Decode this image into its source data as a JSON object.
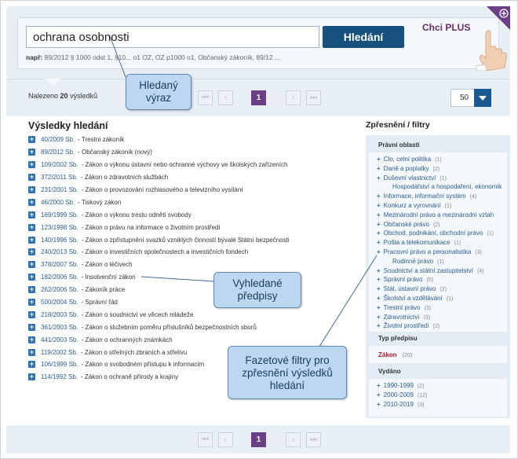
{
  "search": {
    "value": "ochrana osobnosti",
    "button_label": "Hledání",
    "example_label": "např:",
    "example_text": "89/2012 § 1000 odst 1, §10... o1 OZ, OZ p1000 o1, Občanský zákoník, 89/12 ..."
  },
  "promo": {
    "label": "Chci PLUS"
  },
  "pager": {
    "found_prefix": "Nalezeno",
    "found_count": "20",
    "found_suffix": "výsledků",
    "current_page": "1",
    "first": "⏮",
    "prev": "‹",
    "next": "›",
    "last": "⏭",
    "per_page": "50"
  },
  "results": {
    "title": "Výsledky hledání",
    "items": [
      {
        "num": "40/2009 Sb.",
        "title": "- Trestní zákoník"
      },
      {
        "num": "89/2012 Sb.",
        "title": "- Občanský zákoník (nový)"
      },
      {
        "num": "109/2002 Sb.",
        "title": "- Zákon o výkonu ústavní nebo ochranné výchovy ve školských zařízeních"
      },
      {
        "num": "372/2011 Sb.",
        "title": "- Zákon o zdravotních službách"
      },
      {
        "num": "231/2001 Sb.",
        "title": "- Zákon o provozování rozhlasového a televizního vysílání"
      },
      {
        "num": "46/2000 Sb.",
        "title": "- Tiskový zákon"
      },
      {
        "num": "169/1999 Sb.",
        "title": "- Zákon o výkonu trestu odnětí svobody"
      },
      {
        "num": "123/1998 Sb.",
        "title": "- Zákon o právu na informace o životním prostředí"
      },
      {
        "num": "140/1996 Sb.",
        "title": "- Zákon o zpřístupnění svazků vzniklých činností bývalé Státní bezpečnosti"
      },
      {
        "num": "240/2013 Sb.",
        "title": "- Zákon o investičních společnostech a investičních fondech"
      },
      {
        "num": "378/2007 Sb.",
        "title": "- Zákon o léčivech"
      },
      {
        "num": "182/2006 Sb.",
        "title": "- Insolvenční zákon"
      },
      {
        "num": "262/2006 Sb.",
        "title": "- Zákoník práce"
      },
      {
        "num": "500/2004 Sb.",
        "title": "- Správní řád"
      },
      {
        "num": "218/2003 Sb.",
        "title": "- Zákon o soudnictví ve věcech mládeže"
      },
      {
        "num": "361/2003 Sb.",
        "title": "- Zákon o služebním poměru příslušníků bezpečnostních sborů"
      },
      {
        "num": "441/2003 Sb.",
        "title": "- Zákon o ochranných známkách"
      },
      {
        "num": "119/2002 Sb.",
        "title": "- Zákon o střelných zbraních a střelivu"
      },
      {
        "num": "106/1999 Sb.",
        "title": "- Zákon o svobodném přístupu k informacím"
      },
      {
        "num": "114/1992 Sb.",
        "title": "- Zákon o ochraně přírody a krajiny"
      }
    ]
  },
  "filters": {
    "title": "Zpřesnění / filtry",
    "areas_heading": "Právní oblasti",
    "areas": [
      {
        "label": "Clo, celní politika",
        "count": "(1)"
      },
      {
        "label": "Daně a poplatky",
        "count": "(2)"
      },
      {
        "label": "Duševní vlastnictví",
        "count": "(1)"
      },
      {
        "label": "Hospodářství a hospodaření, ekonomik",
        "count": "",
        "sub": true
      },
      {
        "label": "Informace, informační systém",
        "count": "(4)"
      },
      {
        "label": "Konkurz a vyrovnání",
        "count": "(1)"
      },
      {
        "label": "Mezinárodní právo a mezinárodní vztah",
        "count": ""
      },
      {
        "label": "Občanské právo",
        "count": "(2)"
      },
      {
        "label": "Obchod, podnikání, obchodní právo",
        "count": "(1)"
      },
      {
        "label": "Pošta a telekomunikace",
        "count": "(1)"
      },
      {
        "label": "Pracovní právo a personalistika",
        "count": "(3)"
      },
      {
        "label": "Rodinné právo",
        "count": "(1)",
        "sub": true
      },
      {
        "label": "Soudnictví a státní zastupitelství",
        "count": "(4)"
      },
      {
        "label": "Správní právo",
        "count": "(5)"
      },
      {
        "label": "Stát, ústavní právo",
        "count": "(2)"
      },
      {
        "label": "Školství a vzdělávání",
        "count": "(1)"
      },
      {
        "label": "Trestní právo",
        "count": "(3)"
      },
      {
        "label": "Zdravotnictví",
        "count": "(3)"
      },
      {
        "label": "Životní prostředí",
        "count": "(2)"
      }
    ],
    "type_heading": "Typ předpisu",
    "type_active": "Zákon",
    "type_active_count": "(20)",
    "issued_heading": "Vydáno",
    "issued": [
      {
        "label": "1990-1999",
        "count": "(2)"
      },
      {
        "label": "2000-2009",
        "count": "(12)"
      },
      {
        "label": "2010-2019",
        "count": "(3)"
      }
    ]
  },
  "callouts": {
    "query": "Hledaný výraz",
    "found": "Vyhledané předpisy",
    "facets": "Fazetové filtry pro zpřesnění výsledků hledání"
  },
  "colors": {
    "primary_button": "#16507f",
    "current_page": "#6b3f86",
    "link": "#2a5d94",
    "active_filter": "#b0172a",
    "callout": "#bcd7ef"
  }
}
